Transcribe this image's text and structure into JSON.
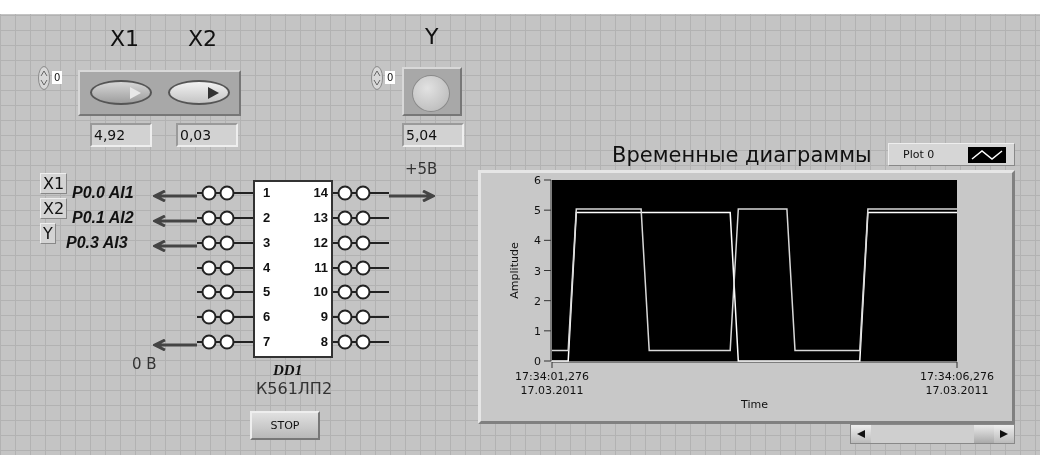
{
  "controls": {
    "index": "0",
    "buttons": [
      {
        "label": "X1",
        "on": false,
        "reading": "4,92"
      },
      {
        "label": "X2",
        "on": true,
        "reading": "0,03"
      }
    ]
  },
  "indicator": {
    "index": "0",
    "label": "Y",
    "lit": false,
    "reading": "5,04"
  },
  "chip": {
    "designator": "DD1",
    "part": "К561ЛП2",
    "left_pins": [
      {
        "number": "1",
        "tag": "X1",
        "channel": "P0.0 AI1"
      },
      {
        "number": "2",
        "tag": "X2",
        "channel": "P0.1 AI2"
      },
      {
        "number": "3",
        "tag": "Y",
        "channel": "P0.3 AI3"
      },
      {
        "number": "4"
      },
      {
        "number": "5"
      },
      {
        "number": "6"
      },
      {
        "number": "7",
        "rail": "0 B"
      }
    ],
    "right_pins": [
      {
        "number": "14",
        "rail": "+5B"
      },
      {
        "number": "13"
      },
      {
        "number": "12"
      },
      {
        "number": "11"
      },
      {
        "number": "10"
      },
      {
        "number": "9"
      },
      {
        "number": "8"
      }
    ]
  },
  "stop_button": "STOP",
  "chart": {
    "chart_data": {
      "type": "line",
      "title": "Временные диаграммы",
      "xlabel": "Time",
      "ylabel": "Amplitude",
      "categories": [
        "17:34:01,276\n17.03.2011",
        null,
        null,
        null,
        null,
        null,
        null,
        null,
        null,
        null,
        null,
        null,
        null,
        null,
        null,
        null,
        null,
        null,
        null,
        null,
        null,
        null,
        null,
        null,
        null,
        null,
        null,
        null,
        null,
        null,
        null,
        null,
        null,
        null,
        null,
        null,
        null,
        null,
        null,
        null,
        null,
        null,
        null,
        null,
        null,
        null,
        null,
        null,
        null,
        null,
        "17:34:06,276\n17.03.2011"
      ],
      "series": [
        {
          "name": "Plot 0",
          "color": "#ffffff",
          "values": [
            0,
            0,
            0,
            4.92,
            4.92,
            4.92,
            4.92,
            4.92,
            4.92,
            4.92,
            4.92,
            4.92,
            4.92,
            4.92,
            4.92,
            4.92,
            4.92,
            4.92,
            4.92,
            4.92,
            4.92,
            4.92,
            4.92,
            0,
            0,
            0,
            0,
            0,
            0,
            0,
            0,
            0,
            0,
            0,
            0,
            0,
            0,
            0,
            0,
            4.92,
            4.92,
            4.92,
            4.92,
            4.92,
            4.92,
            4.92,
            4.92,
            4.92,
            4.92,
            4.92,
            4.92
          ]
        },
        {
          "color": "#d8d8d8",
          "values": [
            0.35,
            0.35,
            0.35,
            5.04,
            5.04,
            5.04,
            5.04,
            5.04,
            5.04,
            5.04,
            5.04,
            5.04,
            0.35,
            0.35,
            0.35,
            0.35,
            0.35,
            0.35,
            0.35,
            0.35,
            0.35,
            0.35,
            0.35,
            5.04,
            5.04,
            5.04,
            5.04,
            5.04,
            5.04,
            5.04,
            0.35,
            0.35,
            0.35,
            0.35,
            0.35,
            0.35,
            0.35,
            0.35,
            0.35,
            5.04,
            5.04,
            5.04,
            5.04,
            5.04,
            5.04,
            5.04,
            5.04,
            5.04,
            5.04,
            5.04,
            5.04
          ]
        }
      ],
      "ylim": [
        0,
        6
      ],
      "yticks": [
        0,
        1,
        2,
        3,
        4,
        5,
        6
      ]
    }
  }
}
